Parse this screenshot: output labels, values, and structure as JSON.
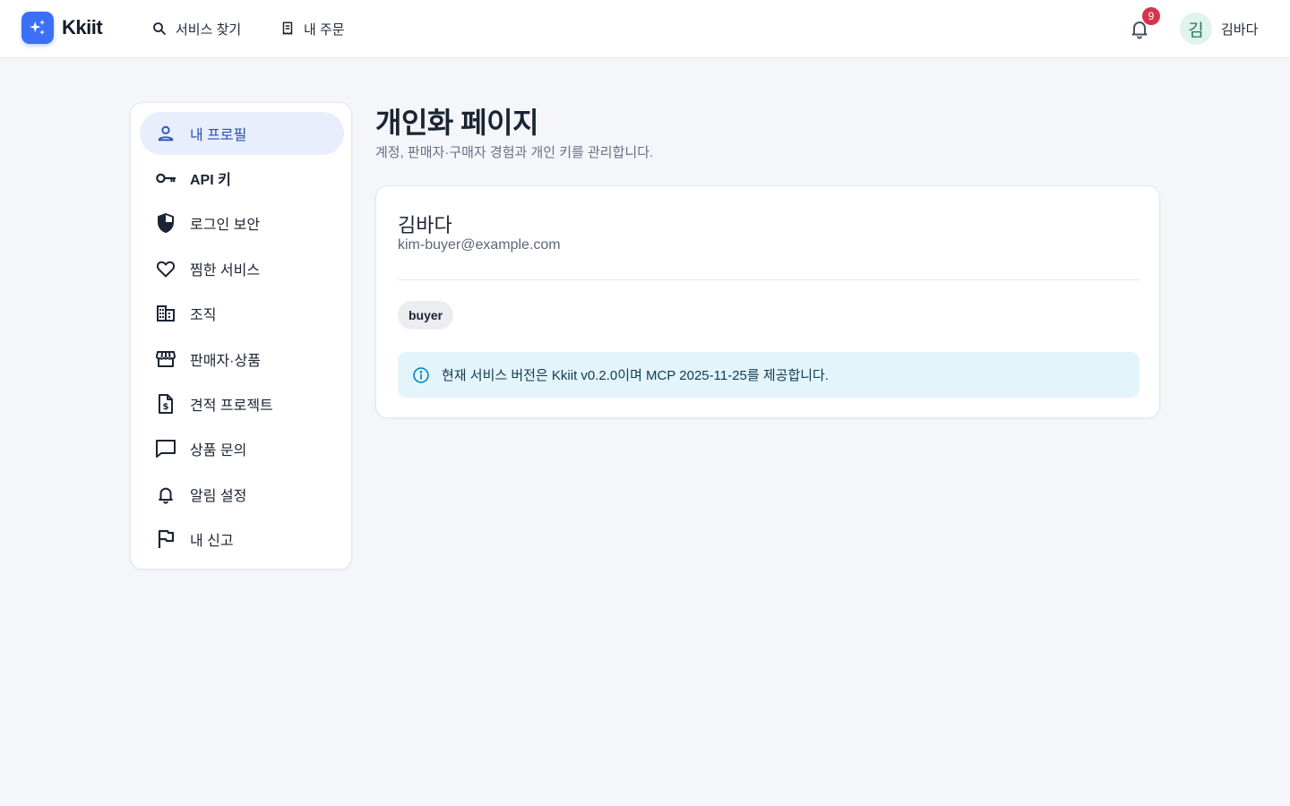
{
  "header": {
    "brand": "Kkiit",
    "nav": [
      {
        "label": "서비스 찾기",
        "icon": "search-icon"
      },
      {
        "label": "내 주문",
        "icon": "receipt-icon"
      }
    ],
    "notification_count": "9",
    "avatar_initial": "김",
    "user_name": "김바다"
  },
  "sidebar": {
    "items": [
      {
        "label": "내 프로필",
        "icon": "person-icon",
        "active": true
      },
      {
        "label": "API 키",
        "icon": "key-icon"
      },
      {
        "label": "로그인 보안",
        "icon": "shield-icon"
      },
      {
        "label": "찜한 서비스",
        "icon": "heart-icon"
      },
      {
        "label": "조직",
        "icon": "building-icon"
      },
      {
        "label": "판매자·상품",
        "icon": "store-icon"
      },
      {
        "label": "견적 프로젝트",
        "icon": "quote-document-icon"
      },
      {
        "label": "상품 문의",
        "icon": "chat-icon"
      },
      {
        "label": "알림 설정",
        "icon": "bell-icon"
      },
      {
        "label": "내 신고",
        "icon": "flag-icon"
      }
    ]
  },
  "main": {
    "title": "개인화 페이지",
    "subtitle": "계정, 판매자·구매자 경험과 개인 키를 관리합니다.",
    "profile": {
      "name": "김바다",
      "email": "kim-buyer@example.com",
      "role": "buyer"
    },
    "info": "현재 서비스 버전은 Kkiit v0.2.0이며 MCP 2025-11-25를 제공합니다."
  },
  "colors": {
    "accent": "#3b6ff5",
    "active_bg": "#e8eefc",
    "badge": "#d6334c",
    "info_bg": "#e3f4fb"
  }
}
